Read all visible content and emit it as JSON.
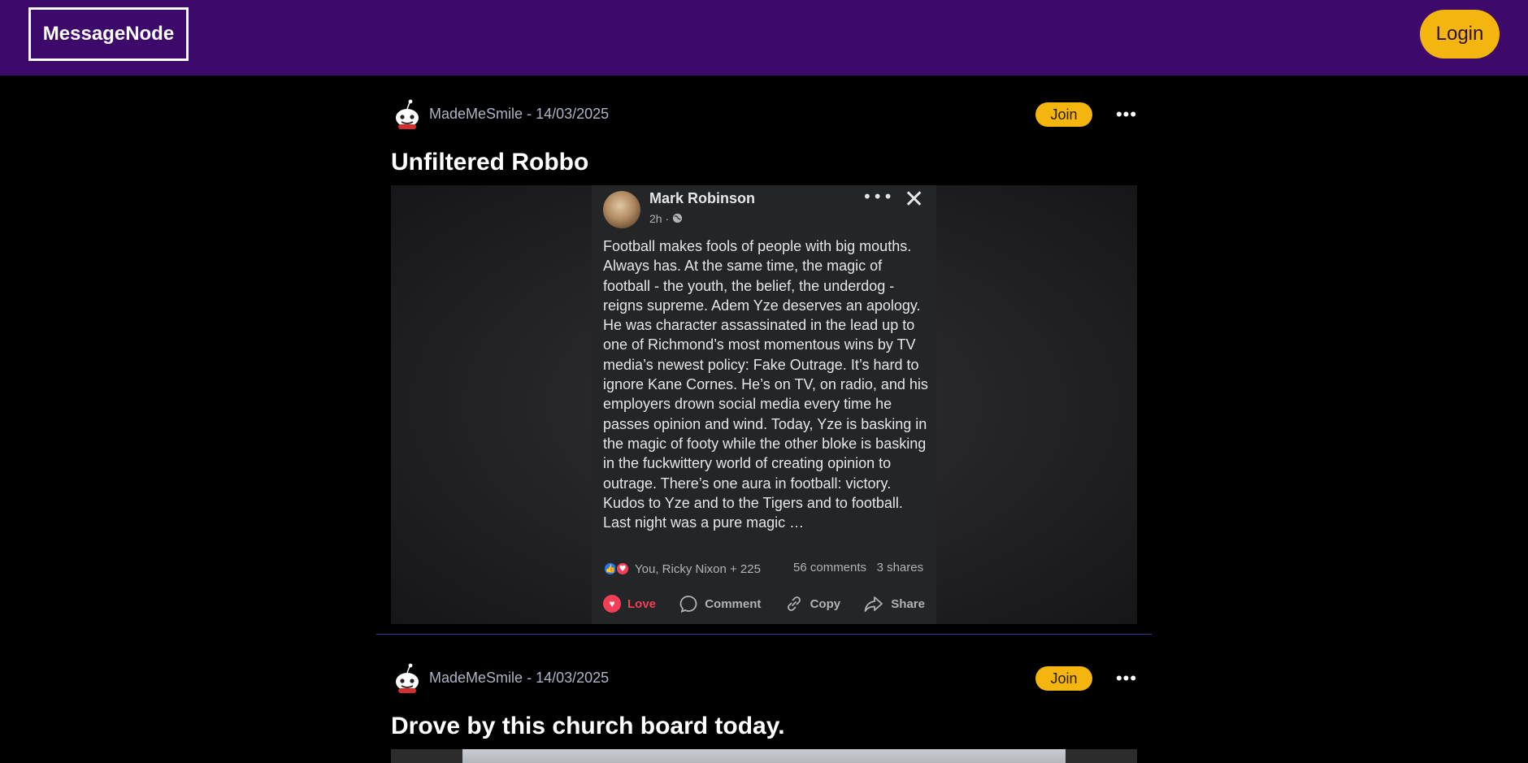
{
  "header": {
    "logo": "MessageNode",
    "login_label": "Login"
  },
  "posts": [
    {
      "community": "MadeMeSmile",
      "separator": "-",
      "date": "14/03/2025",
      "join_label": "Join",
      "more_label": "•••",
      "title": "Unfiltered Robbo",
      "embed": {
        "author": "Mark Robinson",
        "time": "2h · ",
        "body": "Football makes fools of people with  big mouths. Always has. At the same time, the magic of football - the youth, the belief, the underdog - reigns supreme. Adem Yze deserves an apology. He was character assassinated in the lead up to one of Richmond’s most momentous wins by TV media’s newest policy: Fake Outrage. It’s hard to ignore Kane Cornes. He’s on TV, on radio, and his employers drown social media every time he passes opinion and wind. Today, Yze is basking in the magic of footy while the other bloke is basking in the fuckwittery world of creating opinion to outrage. There’s one aura in football: victory. Kudos to Yze and to the Tigers and to football. Last night was a pure magic …",
        "reactions": "You, Ricky Nixon + 225",
        "comments": "56 comments",
        "shares": "3 shares",
        "actions": [
          "Love",
          "Comment",
          "Copy",
          "Share"
        ]
      }
    },
    {
      "community": "MadeMeSmile",
      "separator": "-",
      "date": "14/03/2025",
      "join_label": "Join",
      "more_label": "•••",
      "title": "Drove by this church board today."
    }
  ]
}
